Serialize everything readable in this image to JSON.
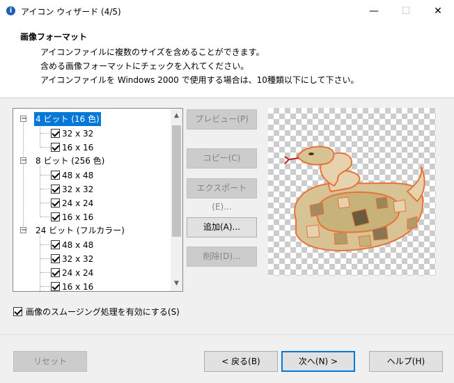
{
  "window": {
    "title": "アイコン ウィザード (4/5)",
    "minimize": "—",
    "maximize": "☐",
    "close": "✕"
  },
  "header": {
    "title": "画像フォーマット",
    "lines": [
      "アイコンファイルに複数のサイズを含めることができます。",
      "含める画像フォーマットにチェックを入れてください。",
      "アイコンファイルを Windows 2000 で使用する場合は、10種類以下にして下さい。"
    ]
  },
  "tree": {
    "groups": [
      {
        "label": "4 ビット (16 色)",
        "expander": "⊟",
        "selected": true,
        "children": [
          {
            "label": "32 x 32",
            "checked": true
          },
          {
            "label": "16 x 16",
            "checked": true
          }
        ]
      },
      {
        "label": "8 ビット (256 色)",
        "expander": "⊟",
        "selected": false,
        "children": [
          {
            "label": "48 x 48",
            "checked": true
          },
          {
            "label": "32 x 32",
            "checked": true
          },
          {
            "label": "24 x 24",
            "checked": true
          },
          {
            "label": "16 x 16",
            "checked": true
          }
        ]
      },
      {
        "label": "24 ビット (フルカラー)",
        "expander": "⊟",
        "selected": false,
        "children": [
          {
            "label": "48 x 48",
            "checked": true
          },
          {
            "label": "32 x 32",
            "checked": true
          },
          {
            "label": "24 x 24",
            "checked": true
          },
          {
            "label": "16 x 16",
            "checked": true
          }
        ]
      }
    ]
  },
  "actions": {
    "preview": "プレビュー(P)",
    "copy": "コピー(C)",
    "export": "エクスポート(E)...",
    "add": "追加(A)...",
    "delete": "削除(D)..."
  },
  "options": {
    "smoothing_label": "画像のスムージング処理を有効にする(S)",
    "smoothing_checked": true
  },
  "footer": {
    "reset": "リセット",
    "back": "< 戻る(B)",
    "next": "次へ(N) >",
    "help": "ヘルプ(H)"
  },
  "colors": {
    "accent": "#0078d7",
    "snake_outline": "#e8723a",
    "snake_fill_light": "#e6d3ad",
    "snake_fill_mid": "#c7b27a",
    "snake_fill_dark": "#6b5b3e"
  },
  "preview_icon": "snake-icon"
}
